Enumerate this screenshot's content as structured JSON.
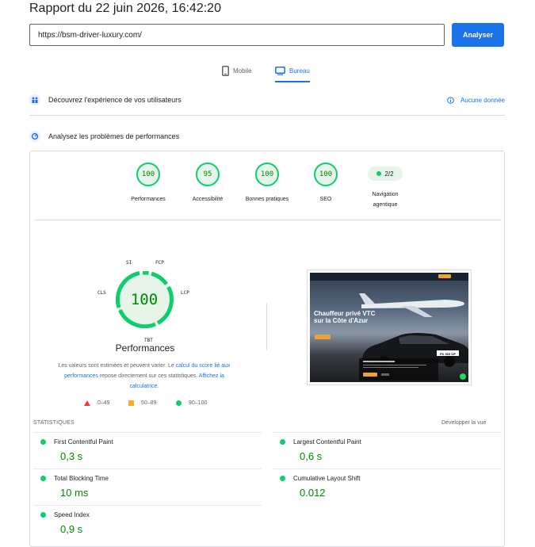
{
  "header": {
    "report_title": "Rapport du 22 juin 2026, 16:42:20",
    "url_value": "https://bsm-driver-luxury.com/",
    "analyze_label": "Analyser"
  },
  "tabs": [
    {
      "label": "Mobile",
      "icon": "phone-icon",
      "selected": false
    },
    {
      "label": "Bureau",
      "icon": "desktop-icon",
      "selected": true
    }
  ],
  "field_section": {
    "title": "Découvrez l'expérience de vos utilisateurs",
    "no_data_label": "Aucune donnée",
    "icon": "users-icon"
  },
  "lab_section": {
    "title": "Analysez les problèmes de performances",
    "icon": "lab-icon"
  },
  "scores": [
    {
      "value": "100",
      "label": "Performances"
    },
    {
      "value": "95",
      "label": "Accessibilité"
    },
    {
      "value": "100",
      "label": "Bonnes pratiques"
    },
    {
      "value": "100",
      "label": "SEO"
    }
  ],
  "agentic": {
    "value": "2/2",
    "label_line1": "Navigation",
    "label_line2": "agentique"
  },
  "performance": {
    "score": "100",
    "title": "Performances",
    "segments": [
      "SI",
      "FCP",
      "LCP",
      "TBT",
      "CLS"
    ],
    "note_text1": "Les valeurs sont estimées et peuvent varier. Le ",
    "note_link1": "calcul du score lié aux performances",
    "note_text2": " repose directement sur ces statistiques. ",
    "note_link2": "Affichez la calculatrice."
  },
  "legend": [
    {
      "range": "0–49",
      "shape": "triangle",
      "color": "#ff3333"
    },
    {
      "range": "50–89",
      "shape": "square",
      "color": "#ffaa33"
    },
    {
      "range": "90–100",
      "shape": "circle",
      "color": "#0cce6b"
    }
  ],
  "screenshot": {
    "headline_line1": "Chauffeur privé VTC",
    "headline_line2": "sur la Côte d'Azur",
    "plate": "FK 965 GP"
  },
  "statistics": {
    "label": "STATISTIQUES",
    "expand_label": "Développer la vue",
    "metrics": [
      {
        "name": "First Contentful Paint",
        "value": "0,3 s"
      },
      {
        "name": "Largest Contentful Paint",
        "value": "0,6 s"
      },
      {
        "name": "Total Blocking Time",
        "value": "10 ms"
      },
      {
        "name": "Cumulative Layout Shift",
        "value": "0.012"
      },
      {
        "name": "Speed Index",
        "value": "0,9 s"
      }
    ]
  },
  "colors": {
    "accent": "#1a73e8",
    "pass": "#0cce6b",
    "pass_text": "#008800",
    "pass_bg": "#e6f4ea"
  }
}
